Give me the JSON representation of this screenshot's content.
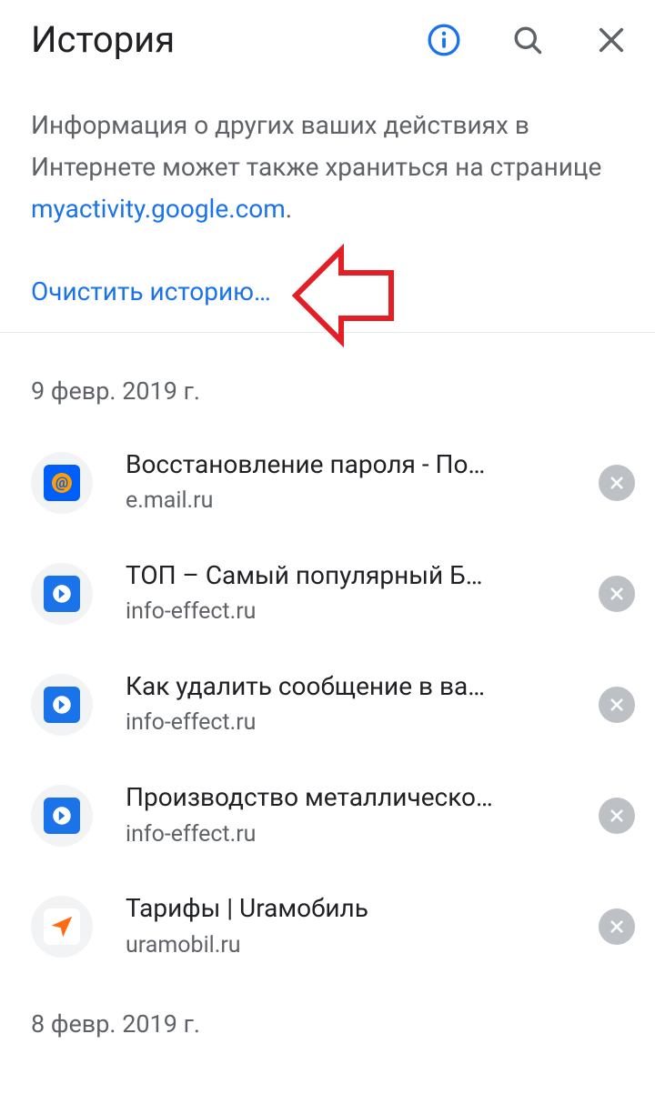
{
  "header": {
    "title": "История"
  },
  "notice": {
    "text": "Информация о других ваших действиях в Интернете может также храниться на странице ",
    "link_text": "myactivity.google.com",
    "period": "."
  },
  "clear": {
    "label": "Очистить историю…"
  },
  "groups": [
    {
      "date": "9 февр. 2019 г.",
      "items": [
        {
          "title": "Восстановление пароля - По…",
          "domain": "e.mail.ru",
          "icon": "mail"
        },
        {
          "title": "ТОП – Самый популярный Б…",
          "domain": "info-effect.ru",
          "icon": "arrow"
        },
        {
          "title": "Как удалить сообщение в ва…",
          "domain": "info-effect.ru",
          "icon": "arrow"
        },
        {
          "title": "Производство металлическо…",
          "domain": "info-effect.ru",
          "icon": "arrow"
        },
        {
          "title": "Тарифы | Uraмобиль",
          "domain": "uramobil.ru",
          "icon": "nav"
        }
      ]
    },
    {
      "date": "8 февр. 2019 г.",
      "items": []
    }
  ],
  "colors": {
    "link": "#1a73e8",
    "text_secondary": "#5f6368",
    "annotation": "#e31e24"
  }
}
